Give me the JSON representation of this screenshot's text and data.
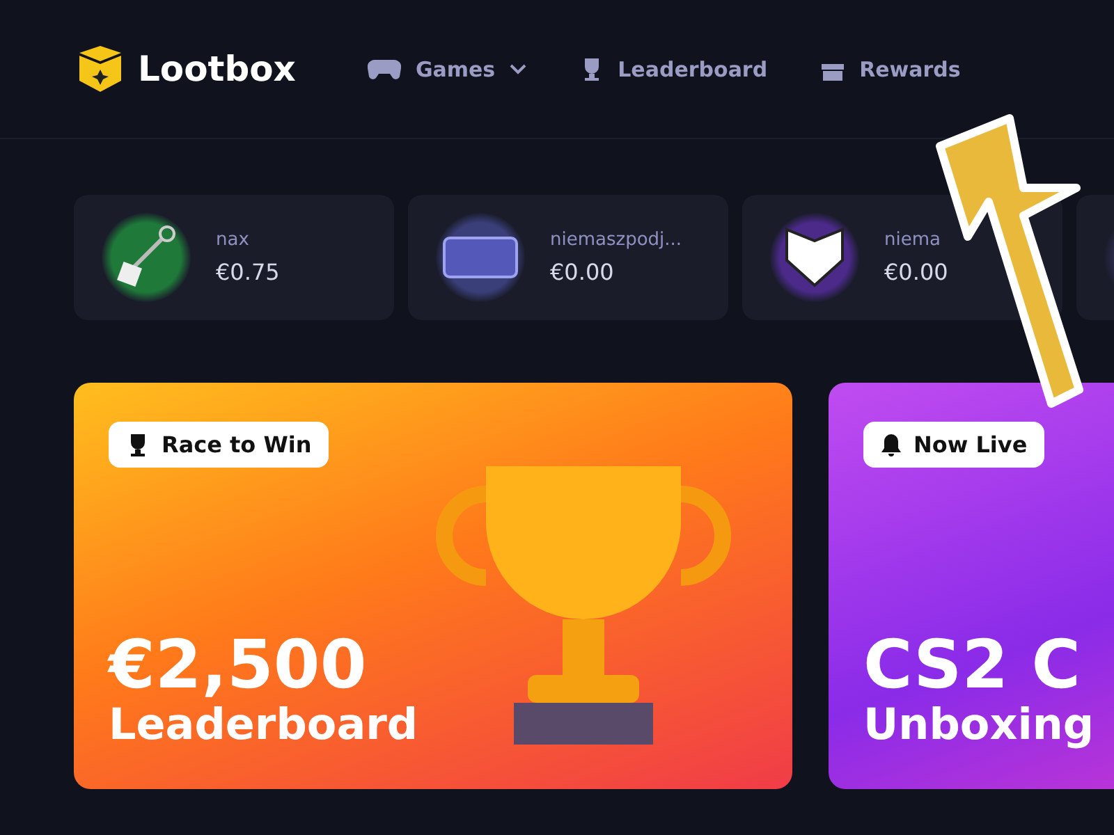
{
  "header": {
    "logo": "Lootbox",
    "nav": [
      {
        "label": "Games",
        "kind": "dropdown"
      },
      {
        "label": "Leaderboard",
        "kind": "trophy"
      },
      {
        "label": "Rewards",
        "kind": "gift"
      }
    ]
  },
  "drops": [
    {
      "name": "nax",
      "price": "€0.75",
      "color": "#1f7a3a",
      "kind": "keychain"
    },
    {
      "name": "niemaszpodj...",
      "price": "€0.00",
      "color": "#3a3f7a",
      "kind": "voucher"
    },
    {
      "name": "niema",
      "price": "€0.00",
      "color": "#4b2a8a",
      "kind": "shield"
    },
    {
      "color": "#2a2a4a",
      "kind": "empty"
    }
  ],
  "banners": [
    {
      "tag": "Race to Win",
      "title": "€2,500",
      "subtitle": "Leaderboard",
      "kind": "leaderboard"
    },
    {
      "tag": "Now Live",
      "title": "CS2 C",
      "subtitle": "Unboxing",
      "kind": "live"
    }
  ]
}
